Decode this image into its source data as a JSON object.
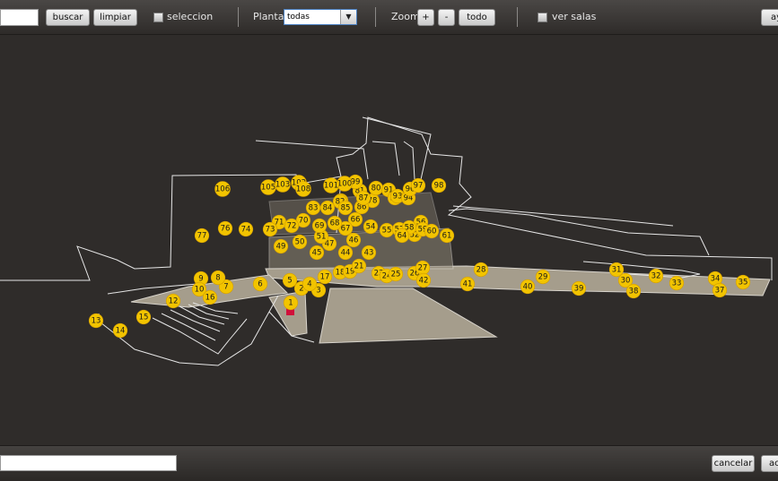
{
  "toolbar": {
    "search_value": "",
    "search_label": "buscar",
    "clear_label": "limpiar",
    "selection_label": "seleccion",
    "floor_label": "Planta",
    "floor_selected": "todas",
    "zoom_label": "Zoom",
    "zoom_in_label": "+",
    "zoom_out_label": "-",
    "zoom_all_label": "todo",
    "rooms_label": "ver salas",
    "help_label": "ay"
  },
  "footer": {
    "text_value": "",
    "cancel_label": "cancelar",
    "accept_label": "ac"
  },
  "colors": {
    "marker": "#f2c400",
    "background": "#2f2c2a",
    "floor_fill": "#a59d8c",
    "outline": "#e0e0e0",
    "selected": "#d0103a"
  },
  "markers": [
    "1",
    "2",
    "3",
    "4",
    "5",
    "6",
    "7",
    "8",
    "9",
    "10",
    "12",
    "13",
    "14",
    "15",
    "16",
    "17",
    "18",
    "19",
    "21",
    "23",
    "24",
    "25",
    "26",
    "27",
    "28",
    "29",
    "30",
    "31",
    "32",
    "33",
    "34",
    "35",
    "37",
    "38",
    "39",
    "40",
    "41",
    "42",
    "43",
    "44",
    "45",
    "46",
    "47",
    "49",
    "50",
    "51",
    "52",
    "54",
    "55",
    "56",
    "57",
    "58",
    "59",
    "60",
    "61",
    "64",
    "66",
    "67",
    "68",
    "69",
    "70",
    "71",
    "72",
    "73",
    "74",
    "76",
    "77",
    "78",
    "79",
    "80",
    "81",
    "82",
    "83",
    "84",
    "85",
    "86",
    "87",
    "91",
    "92",
    "93",
    "94",
    "96",
    "97",
    "98",
    "99",
    "100",
    "101",
    "102",
    "103",
    "105",
    "106",
    "108"
  ]
}
